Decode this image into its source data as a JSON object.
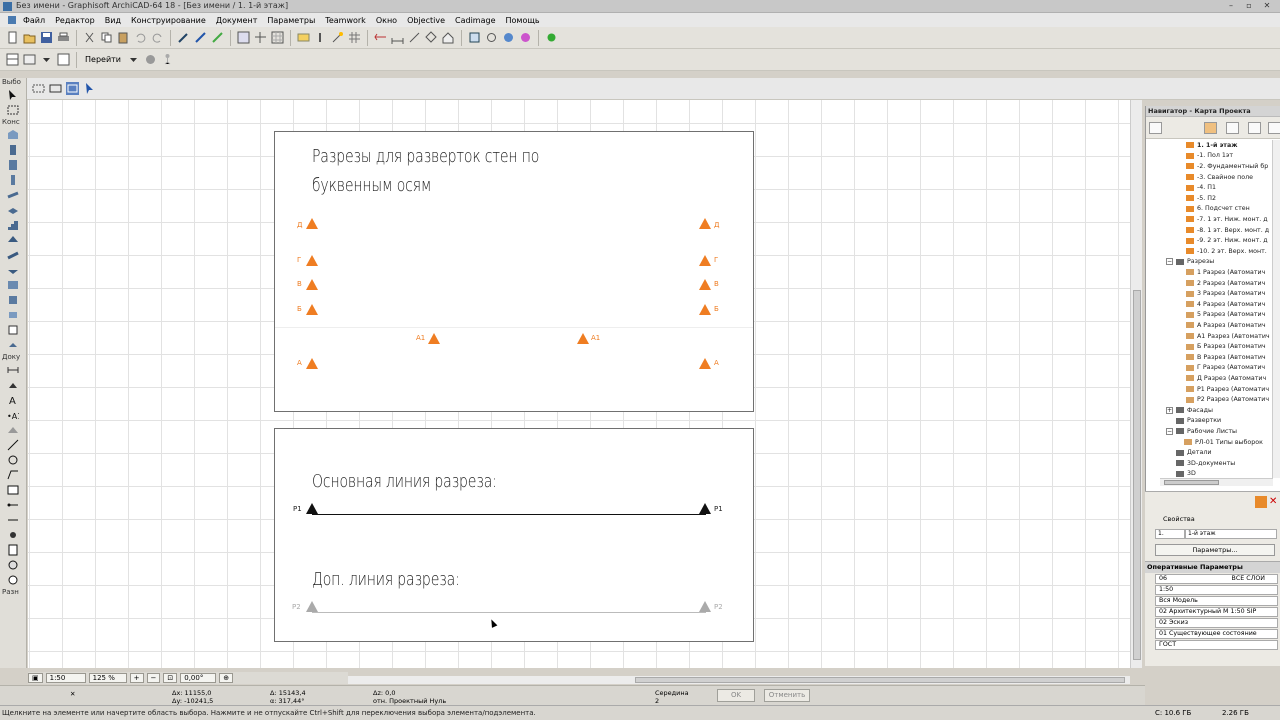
{
  "window": {
    "title": "Без имени - Graphisoft ArchiCAD-64 18 - [Без имени / 1. 1-й этаж]"
  },
  "menu": [
    "Файл",
    "Редактор",
    "Вид",
    "Конструирование",
    "Документ",
    "Параметры",
    "Teamwork",
    "Окно",
    "Objective",
    "Cadimage",
    "Помощь"
  ],
  "toolbar2": {
    "goto_label": "Перейти"
  },
  "toolbox": {
    "select_label": "Выбо",
    "construct_label": "Конс",
    "doc_label": "Доку",
    "more_label": "Разн"
  },
  "drawing": {
    "panel1_title_line1": "Разрезы для разверток стен по",
    "panel1_title_line2": "буквенным осям",
    "panel2_title_main": "Основная линия разреза:",
    "panel2_title_aux": "Доп. линия разреза:",
    "markers_left": [
      {
        "label": "Д"
      },
      {
        "label": "Г"
      },
      {
        "label": "В"
      },
      {
        "label": "Б"
      },
      {
        "label": "А"
      }
    ],
    "markers_right": [
      {
        "label": "Д"
      },
      {
        "label": "Г"
      },
      {
        "label": "В"
      },
      {
        "label": "Б"
      },
      {
        "label": "А"
      }
    ],
    "marker_a1_left": "А1",
    "marker_a1_right": "А1",
    "main_left": "Р1",
    "main_right": "Р1",
    "aux_left": "Р2",
    "aux_right": "Р2",
    "colors": {
      "orange": "#ef7d22",
      "black": "#111111",
      "gray": "#aaaaaa"
    }
  },
  "status_line": {
    "scale": "1:50",
    "zoom": "125 %",
    "angle": "0,00°"
  },
  "coords": {
    "dx": "Δx: 11155,0",
    "dy": "Δy: -10241,5",
    "a": "Δ: 15143,4",
    "alpha": "α: 317,44°",
    "dz": "Δz: 0,0",
    "ref": "отн. Проектный Нуль",
    "snap_label": "Середина",
    "snap_value": "2",
    "ok": "OK",
    "cancel": "Отменить"
  },
  "statusbar": {
    "message": "Щелкните на элементе или начертите область выбора. Нажмите и не отпускайте Ctrl+Shift для переключения выбора элемента/подэлемента.",
    "disk1": "С: 10.6 ГБ",
    "disk2": "2.26 ГБ"
  },
  "navigator": {
    "title": "Навигатор - Карта Проекта",
    "items": [
      {
        "label": "1. 1-й этаж",
        "level": 3,
        "icon": "story"
      },
      {
        "label": "-1. Пол 1эт",
        "level": 3,
        "icon": "story"
      },
      {
        "label": "-2. Фундаментный бр",
        "level": 3,
        "icon": "story"
      },
      {
        "label": "-3. Свайное поле",
        "level": 3,
        "icon": "story"
      },
      {
        "label": "-4. П1",
        "level": 3,
        "icon": "story"
      },
      {
        "label": "-5. П2",
        "level": 3,
        "icon": "story"
      },
      {
        "label": "6. Подсчет стен",
        "level": 3,
        "icon": "story"
      },
      {
        "label": "-7. 1 эт. Ниж. монт. д",
        "level": 3,
        "icon": "story"
      },
      {
        "label": "-8. 1 эт. Верх. монт. д",
        "level": 3,
        "icon": "story"
      },
      {
        "label": "-9. 2 эт. Ниж. монт. д",
        "level": 3,
        "icon": "story"
      },
      {
        "label": "-10. 2 эт. Верх. монт.",
        "level": 3,
        "icon": "story"
      },
      {
        "label": "Разрезы",
        "level": 1,
        "icon": "group",
        "expander": "−"
      },
      {
        "label": "1 Разрез (Автоматич",
        "level": 3,
        "icon": "section"
      },
      {
        "label": "2 Разрез (Автоматич",
        "level": 3,
        "icon": "section"
      },
      {
        "label": "3 Разрез (Автоматич",
        "level": 3,
        "icon": "section"
      },
      {
        "label": "4 Разрез (Автоматич",
        "level": 3,
        "icon": "section"
      },
      {
        "label": "5 Разрез (Автоматич",
        "level": 3,
        "icon": "section"
      },
      {
        "label": "А Разрез (Автоматич",
        "level": 3,
        "icon": "section"
      },
      {
        "label": "А1 Разрез (Автоматич",
        "level": 3,
        "icon": "section"
      },
      {
        "label": "Б Разрез (Автоматич",
        "level": 3,
        "icon": "section"
      },
      {
        "label": "В Разрез (Автоматич",
        "level": 3,
        "icon": "section"
      },
      {
        "label": "Г Разрез (Автоматич",
        "level": 3,
        "icon": "section"
      },
      {
        "label": "Д Разрез (Автоматич",
        "level": 3,
        "icon": "section"
      },
      {
        "label": "Р1 Разрез (Автоматич",
        "level": 3,
        "icon": "section"
      },
      {
        "label": "Р2 Разрез (Автоматич",
        "level": 3,
        "icon": "section"
      },
      {
        "label": "Фасады",
        "level": 1,
        "icon": "group",
        "expander": "+"
      },
      {
        "label": "Развертки",
        "level": 1,
        "icon": "group"
      },
      {
        "label": "Рабочие Листы",
        "level": 1,
        "icon": "group",
        "expander": "−"
      },
      {
        "label": "РЛ-01 Типы выборок",
        "level": 2,
        "icon": "section"
      },
      {
        "label": "Детали",
        "level": 1,
        "icon": "group"
      },
      {
        "label": "3D-документы",
        "level": 1,
        "icon": "group"
      },
      {
        "label": "3D",
        "level": 1,
        "icon": "group"
      }
    ]
  },
  "properties": {
    "title": "Свойства",
    "id": "1.",
    "name": "1-й этаж",
    "button": "Параметры..."
  },
  "quick_options": {
    "title": "Оперативные Параметры",
    "rows": [
      {
        "left": "06",
        "right": "ВСЕ СЛОИ"
      },
      {
        "left": "1:50",
        "right": ""
      },
      {
        "left": "Вся Модель",
        "right": ""
      },
      {
        "left": "02 Архитектурный М 1:50 SIP",
        "right": ""
      },
      {
        "left": "02 Эскиз",
        "right": ""
      },
      {
        "left": "01 Существующее состояние",
        "right": ""
      },
      {
        "left": "ГОСТ",
        "right": ""
      }
    ]
  }
}
